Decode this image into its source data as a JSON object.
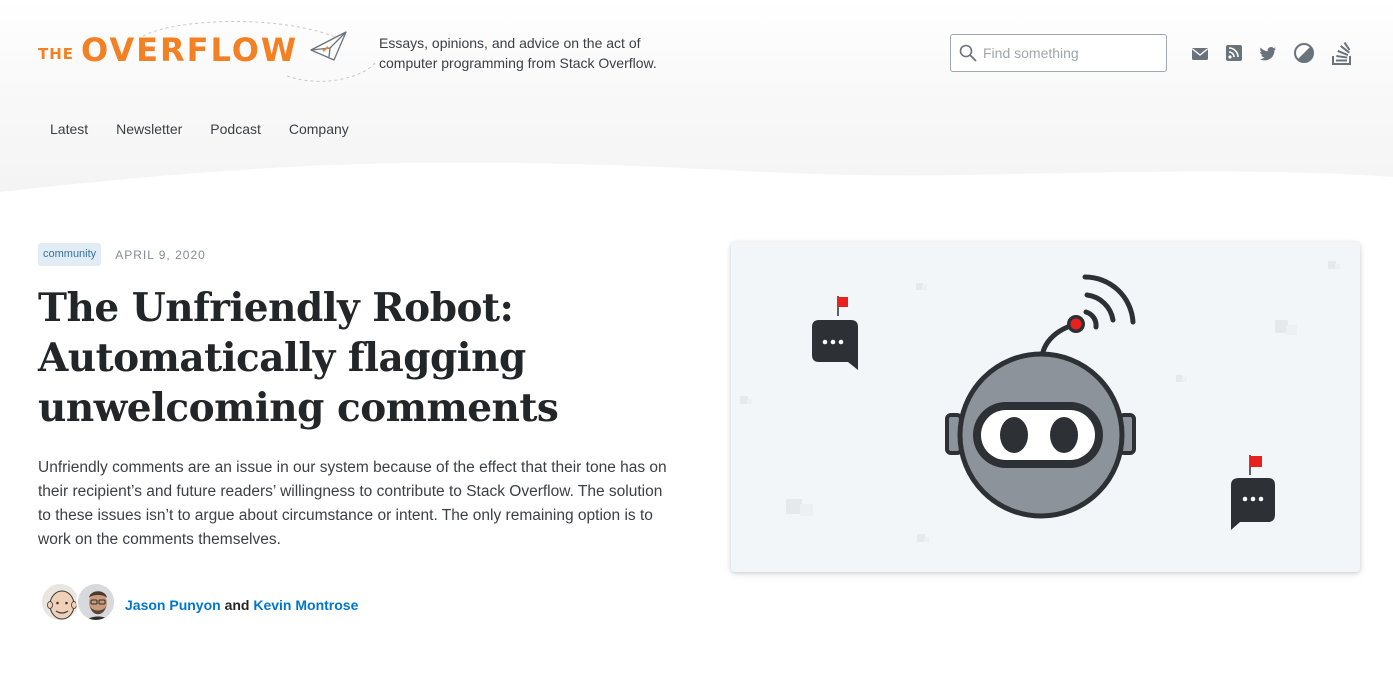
{
  "brand": {
    "logo_the": "THE",
    "logo_overflow": "OVERFLOW",
    "tagline": "Essays, opinions, and advice on the act of computer programming from Stack Overflow.",
    "accent_color": "#f48024"
  },
  "search": {
    "placeholder": "Find something",
    "value": ""
  },
  "social_links": [
    "envelope-icon",
    "rss-icon",
    "twitter-icon",
    "theme-toggle-icon",
    "stackoverflow-icon"
  ],
  "nav": {
    "items": [
      {
        "label": "Latest"
      },
      {
        "label": "Newsletter"
      },
      {
        "label": "Podcast"
      },
      {
        "label": "Company"
      }
    ]
  },
  "article": {
    "tag": "community",
    "date": "APRIL 9, 2020",
    "title": "The Unfriendly Robot: Automatically flagging unwelcoming comments",
    "excerpt": "Unfriendly comments are an issue in our system because of the effect that their tone has on their recipient’s and future readers’ willingness to contribute to Stack Overflow. The solution to these issues isn’t to argue about circumstance or intent. The only remaining option is to work on the comments themselves.",
    "authors": [
      {
        "name": "Jason Punyon"
      },
      {
        "name": "Kevin Montrose"
      }
    ],
    "author_joiner": "and"
  },
  "hero": {
    "icon": "robot-illustration",
    "link_color": "#0077cc"
  }
}
